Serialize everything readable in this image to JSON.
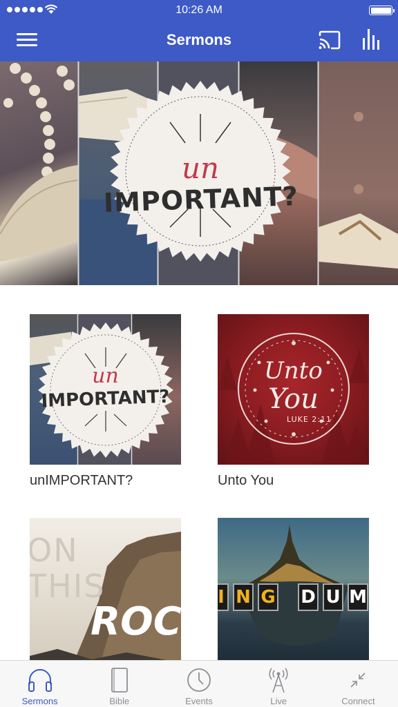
{
  "status_bar": {
    "time": "10:26 AM"
  },
  "nav": {
    "title": "Sermons",
    "menu_icon": "hamburger-menu-icon",
    "cast_icon": "cast-icon",
    "stats_icon": "bar-chart-icon"
  },
  "hero": {
    "line1": "un",
    "line2": "IMPORTANT?",
    "page_count": 2,
    "active_page": 1
  },
  "series": [
    {
      "title": "unIMPORTANT?",
      "art_line1": "un",
      "art_line2": "IMPORTANT?"
    },
    {
      "title": "Unto You",
      "art_line1": "Unto",
      "art_line2": "You",
      "art_ref": "LUKE 2:11"
    },
    {
      "title": "",
      "art_lines": [
        "ON",
        "THIS",
        "ROC"
      ]
    },
    {
      "title": "",
      "art_letters": [
        "I",
        "N",
        "G",
        "D",
        "U",
        "M"
      ]
    }
  ],
  "tabs": [
    {
      "label": "Sermons",
      "icon": "headphones-icon",
      "active": true
    },
    {
      "label": "Bible",
      "icon": "book-icon",
      "active": false
    },
    {
      "label": "Events",
      "icon": "clock-icon",
      "active": false
    },
    {
      "label": "Live",
      "icon": "broadcast-tower-icon",
      "active": false
    },
    {
      "label": "Connect",
      "icon": "compress-arrows-icon",
      "active": false
    }
  ],
  "colors": {
    "accent": "#3d5ac6",
    "inactive_tab": "#8e8e93",
    "title_red": "#c03a4b"
  }
}
